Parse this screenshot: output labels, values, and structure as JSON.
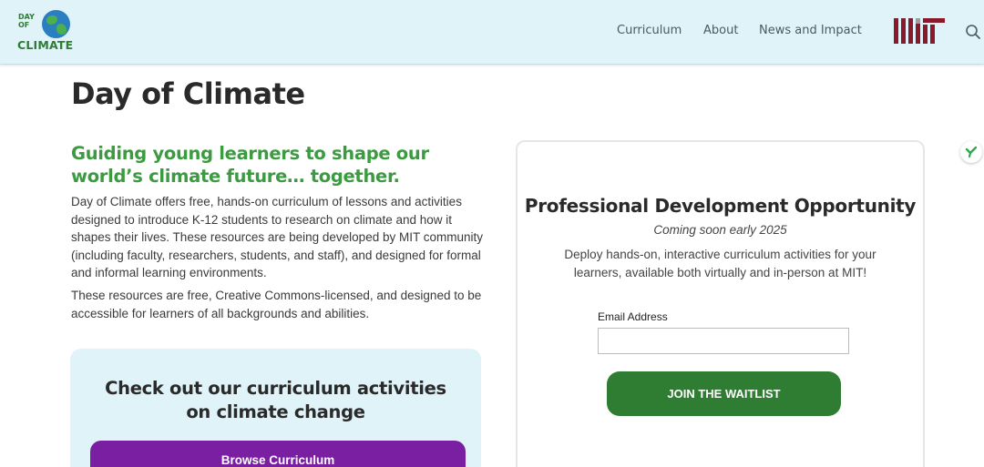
{
  "header": {
    "logo": {
      "line1": "DAY",
      "line2": "OF",
      "letter_o": "O",
      "bottom": "CLIMATE"
    },
    "nav": [
      {
        "label": "Curriculum"
      },
      {
        "label": "About"
      },
      {
        "label": "News and Impact"
      }
    ],
    "partner_logo": "MIT",
    "search_icon": "search-icon"
  },
  "main": {
    "title": "Day of Climate",
    "tagline": "Guiding young learners to shape our world’s climate future… together.",
    "intro": "Day of Climate offers free, hands-on curriculum of lessons and activities designed to introduce K-12 students to research on climate and how it shapes their lives. These resources are being developed by MIT community (including faculty, researchers, students, and staff), and designed for formal and informal learning environments.",
    "intro2": "These resources are free, Creative Commons-licensed, and designed to be accessible for learners of all backgrounds and abilities.",
    "cta": {
      "title": "Check out our curriculum activities on climate change",
      "button": "Browse Curriculum"
    }
  },
  "pd_card": {
    "title": "Professional Development Opportunity",
    "subtitle": "Coming soon early 2025",
    "description": "Deploy hands-on, interactive curriculum activities for your learners, available both virtually and in-person at MIT!",
    "email_label": "Email Address",
    "email_value": "",
    "button": "JOIN THE WAITLIST"
  },
  "colors": {
    "header_bg": "#dff3f8",
    "brand_green": "#2e7d32",
    "tagline_green": "#3c9a40",
    "browse_purple": "#7b1fa2",
    "mit_red": "#8a1a2b"
  }
}
